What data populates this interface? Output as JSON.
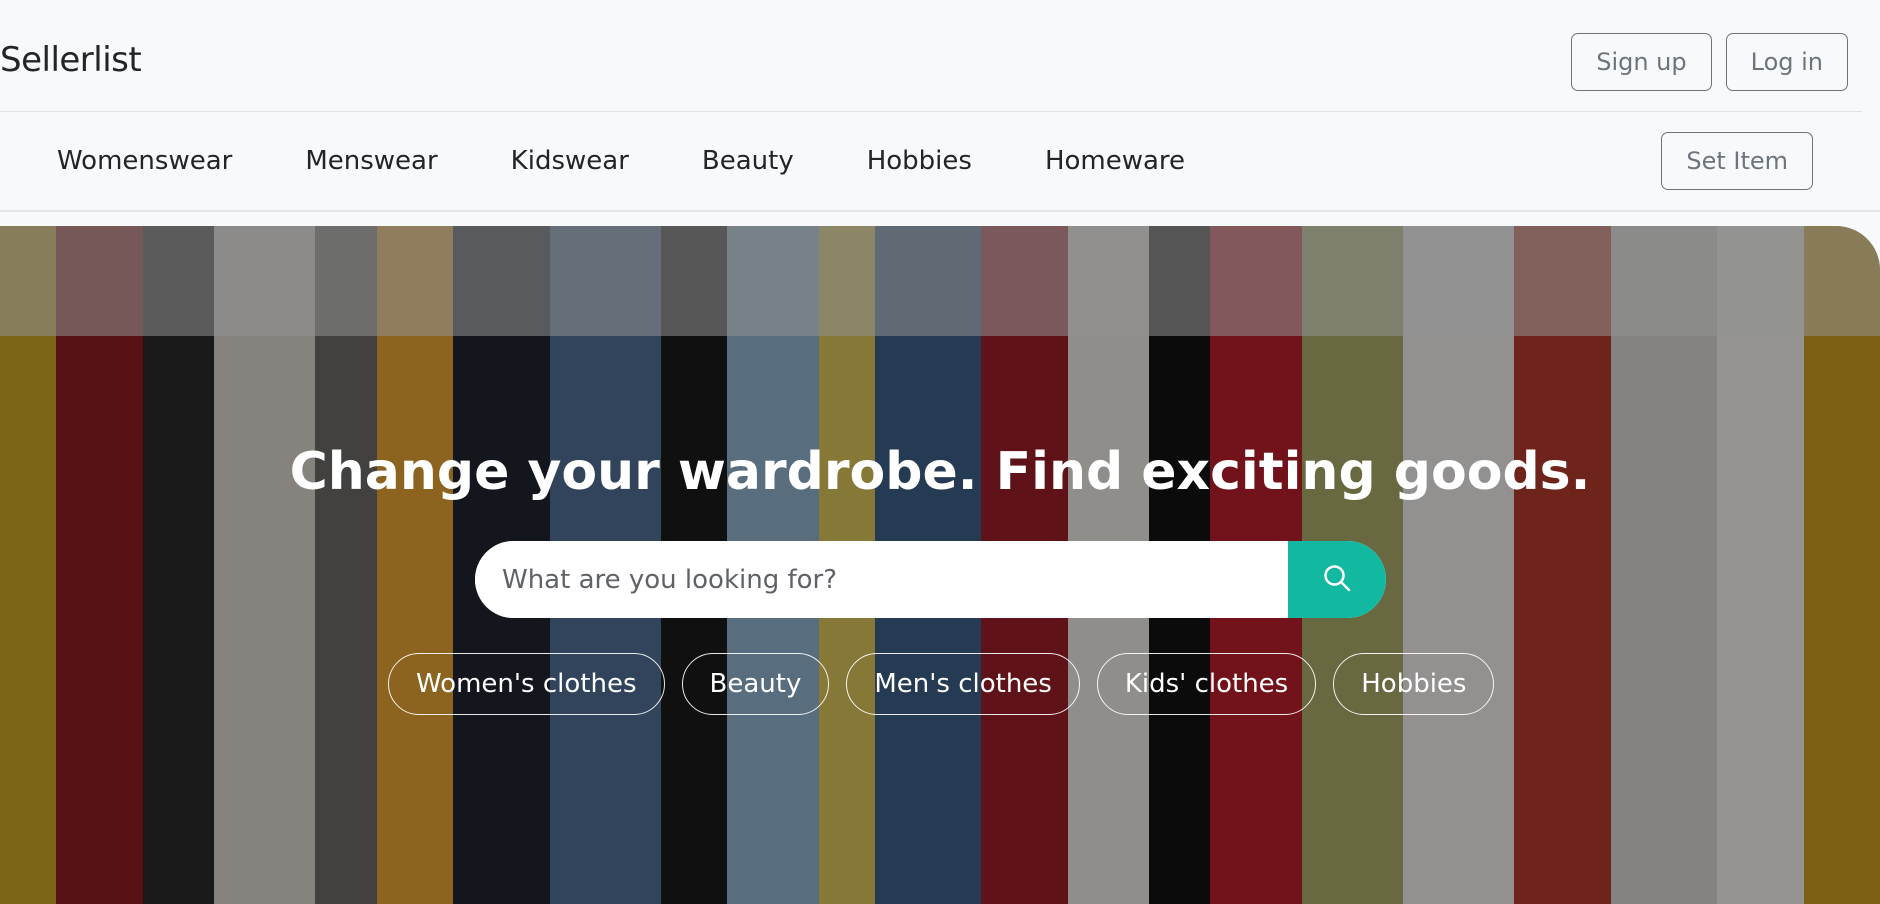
{
  "header": {
    "brand": "Sellerlist",
    "sign_up_label": "Sign up",
    "log_in_label": "Log in"
  },
  "categories": {
    "items": [
      "Womenswear",
      "Menswear",
      "Kidswear",
      "Beauty",
      "Hobbies",
      "Homeware"
    ],
    "set_item_label": "Set Item"
  },
  "hero": {
    "title": "Change your wardrobe. Find exciting goods.",
    "search_placeholder": "What are you looking for?",
    "search_icon": "search-icon",
    "chips": [
      "Women's clothes",
      "Beauty",
      "Men's clothes",
      "Kids' clothes",
      "Hobbies"
    ]
  },
  "colors": {
    "accent": "#12b8a0",
    "navbar_bg": "#f8f9fa",
    "outline_button": "#6c757d"
  }
}
